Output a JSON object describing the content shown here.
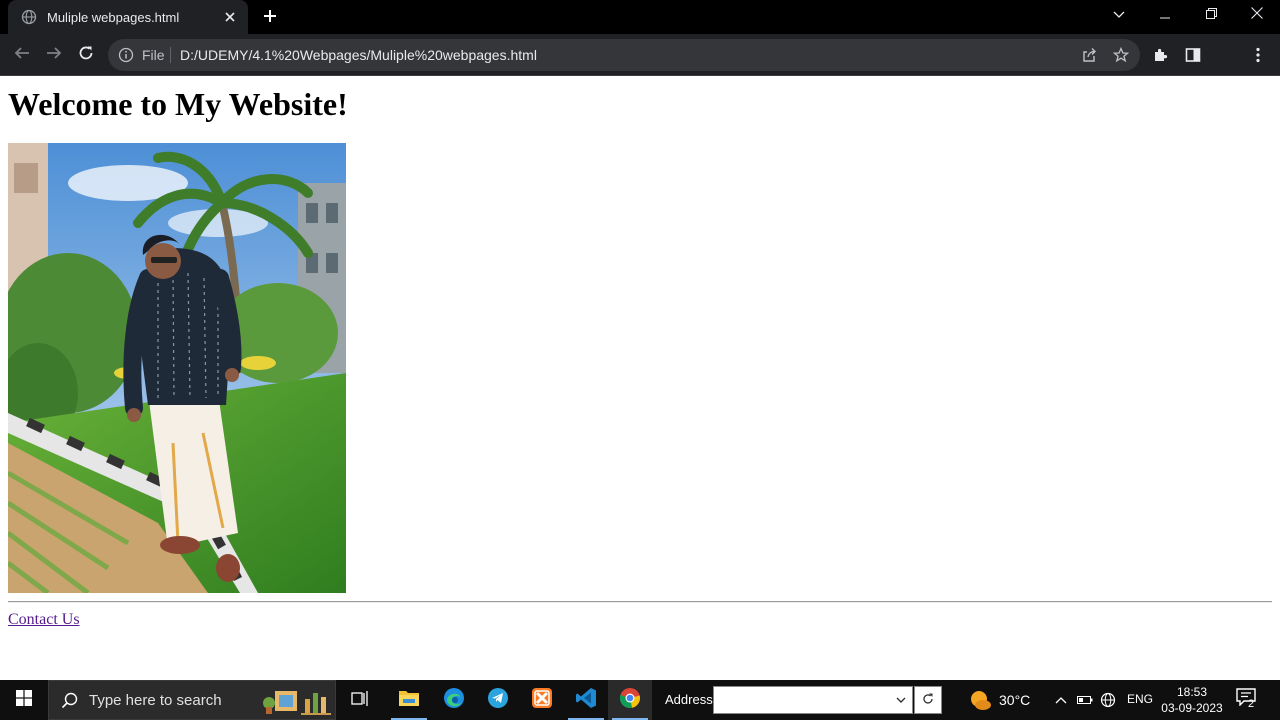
{
  "browser": {
    "tab_title": "Muliple webpages.html",
    "omnibox_scheme_label": "File",
    "url": "D:/UDEMY/4.1%20Webpages/Muliple%20webpages.html"
  },
  "page": {
    "heading": "Welcome to My Website!",
    "image_alt": "photo of a person in a dark shirt and white dhoti on a grass lawn under palm trees",
    "contact_link": "Contact Us"
  },
  "taskbar": {
    "search_placeholder": "Type here to search",
    "address_label": "Address",
    "address_value": "",
    "temperature": "30°C",
    "language": "ENG",
    "time": "18:53",
    "date": "03-09-2023",
    "notification_count": "2"
  },
  "icons": {
    "tab": [
      "globe-icon",
      "close-icon",
      "plus-icon"
    ],
    "window": [
      "chevron-down-icon",
      "minimize-icon",
      "restore-icon",
      "close-icon"
    ],
    "toolbar": [
      "back-icon",
      "forward-icon",
      "reload-icon",
      "info-icon",
      "share-icon",
      "star-icon",
      "puzzle-icon",
      "sidepanel-icon",
      "avatar",
      "kebab-menu-icon"
    ],
    "taskbar": [
      "windows-start-icon",
      "search-icon",
      "task-view-icon",
      "file-explorer-icon",
      "edge-icon",
      "telegram-icon",
      "xampp-icon",
      "vscode-icon",
      "chrome-icon"
    ]
  },
  "colors": {
    "tabstrip_bg": "#000000",
    "toolbar_bg": "#202124",
    "omnibox_bg": "#35363a",
    "link_visited": "#551a8b",
    "taskbar_bg": "#0f0f0f"
  }
}
